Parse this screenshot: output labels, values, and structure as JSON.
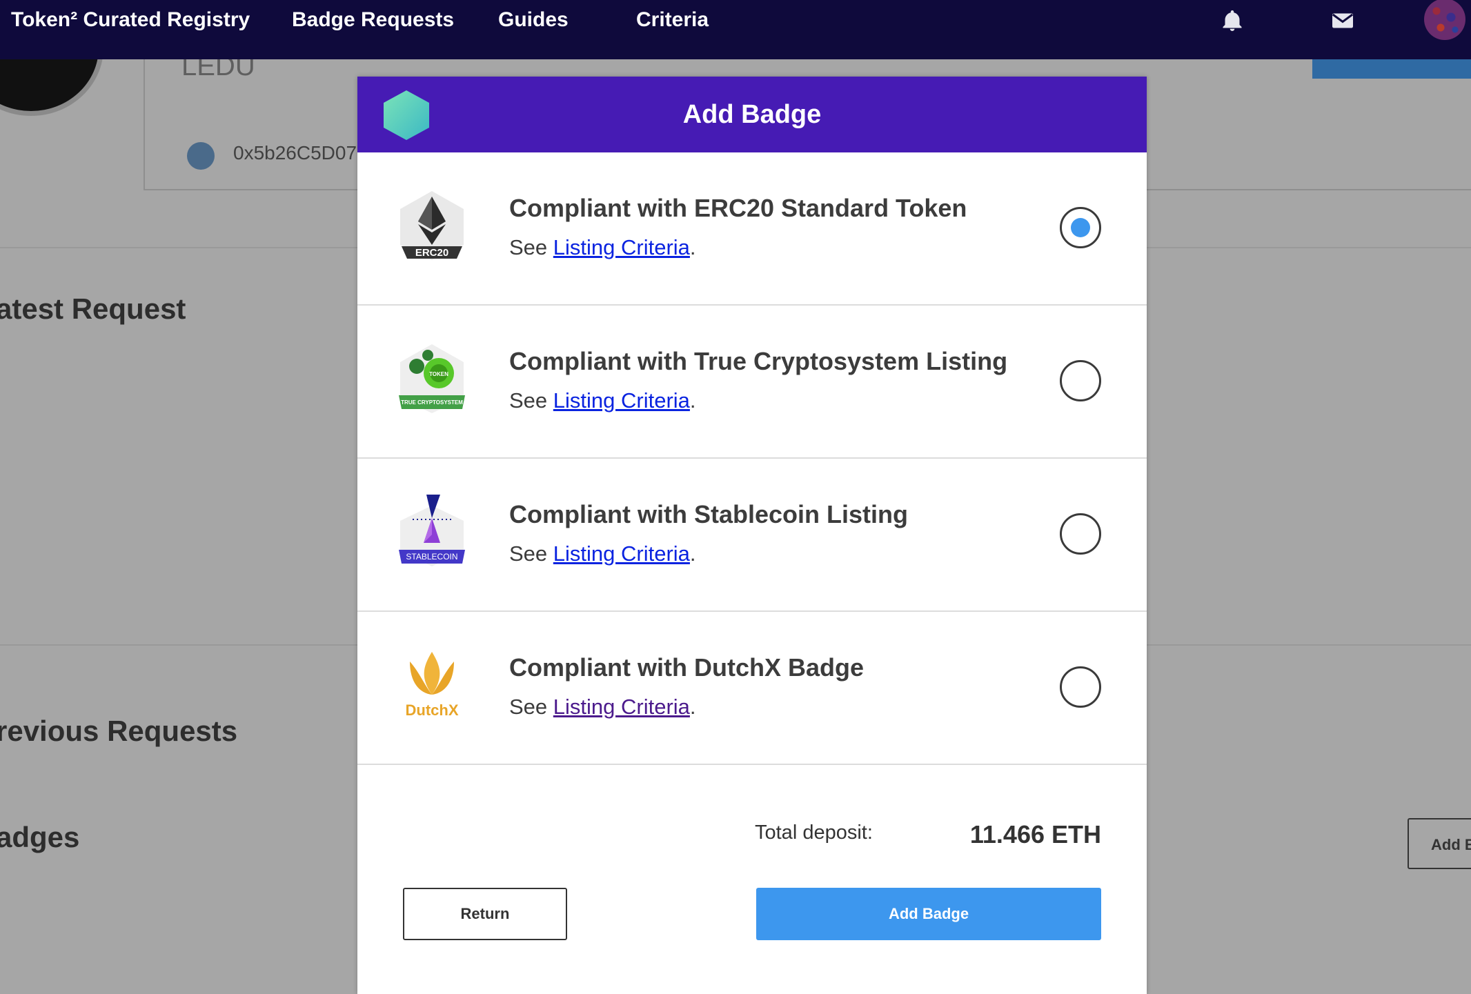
{
  "nav": {
    "brand": "Token² Curated Registry",
    "links": [
      "Badge Requests",
      "Guides",
      "Criteria"
    ],
    "icons": [
      "bell-icon",
      "mail-icon",
      "avatar"
    ]
  },
  "background": {
    "ticker": "LEDU",
    "address": "0x5b26C5D07",
    "headings": [
      "atest Request",
      "revious Requests",
      "adges"
    ],
    "add_button": "Add B"
  },
  "modal": {
    "title": "Add Badge",
    "badges": [
      {
        "title": "Compliant with ERC20 Standard Token",
        "see": "See",
        "link": "Listing Criteria",
        "suffix": ".",
        "icon": "erc20-badge-icon",
        "icon_label": "ERC20",
        "selected": true
      },
      {
        "title": "Compliant with True Cryptosystem Listing",
        "see": "See",
        "link": "Listing Criteria",
        "suffix": ".",
        "icon": "true-cryptosystem-badge-icon",
        "icon_label": "TRUE CRYPTOSYSTEM",
        "icon_sublabel": "TOKEN",
        "selected": false
      },
      {
        "title": "Compliant with Stablecoin Listing",
        "see": "See",
        "link": "Listing Criteria",
        "suffix": ".",
        "icon": "stablecoin-badge-icon",
        "icon_label": "STABLECOIN",
        "selected": false
      },
      {
        "title": "Compliant with DutchX Badge",
        "see": "See",
        "link": "Listing Criteria",
        "suffix": ".",
        "icon": "dutchx-badge-icon",
        "icon_label": "DutchX",
        "selected": false
      }
    ],
    "deposit_label": "Total deposit:",
    "deposit_value": "11.466 ETH",
    "return_label": "Return",
    "submit_label": "Add Badge"
  },
  "colors": {
    "nav_bg": "#0f0a3c",
    "modal_header": "#461bb4",
    "accent_blue": "#3d97ee",
    "link_blue": "#0a23e0",
    "link_visited": "#4b1a8c"
  }
}
